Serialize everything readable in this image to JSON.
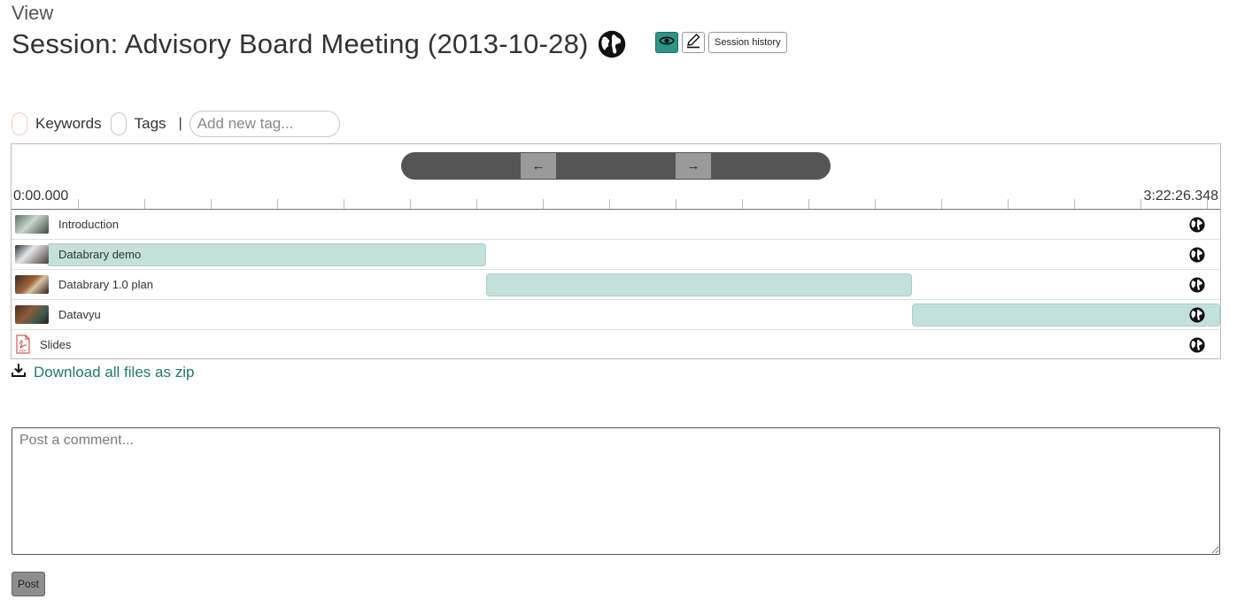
{
  "header": {
    "view_label": "View",
    "title": "Session: Advisory Board Meeting (2013-10-28)",
    "session_history_label": "Session history"
  },
  "filters": {
    "keywords_label": "Keywords",
    "tags_label": "Tags",
    "separator": "|",
    "tag_placeholder": "Add new tag..."
  },
  "timeline": {
    "prev_label": "←",
    "next_label": "→",
    "start_time": "0:00.000",
    "end_time": "3:22:26.348",
    "tracks": [
      {
        "name": "Introduction",
        "type": "video",
        "has_segment": false
      },
      {
        "name": "Databrary demo",
        "type": "video",
        "has_segment": true
      },
      {
        "name": "Databrary 1.0 plan",
        "type": "video",
        "has_segment": true
      },
      {
        "name": "Datavyu",
        "type": "video",
        "has_segment": true
      },
      {
        "name": "Slides",
        "type": "pdf",
        "has_segment": false
      }
    ]
  },
  "download": {
    "label": "Download all files as zip"
  },
  "comment": {
    "placeholder": "Post a comment...",
    "post_label": "Post"
  },
  "colors": {
    "accent": "#2e9486",
    "segment": "#c3e1da",
    "link": "#1f7a66"
  },
  "icons": [
    "globe-icon",
    "eye-icon",
    "pencil-icon",
    "download-icon",
    "pdf-icon"
  ]
}
